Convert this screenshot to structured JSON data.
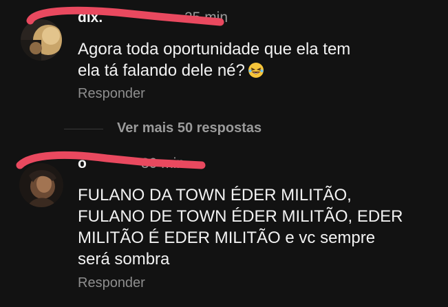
{
  "comments": [
    {
      "username": "dix.",
      "time": "25 min",
      "text": "Agora toda oportunidade que ela tem\nela tá falando dele né?",
      "emoji": "grinning-squinting-face",
      "reply_label": "Responder"
    },
    {
      "username": "o",
      "time": "30 min",
      "text": "FULANO DA TOWN ÉDER MILITÃO,\nFULANO DE TOWN ÉDER MILITÃO, EDER\nMILITÃO É EDER MILITÃO e vc sempre\nserá sombra",
      "reply_label": "Responder"
    }
  ],
  "more_replies_label": "Ver mais 50 respostas",
  "colors": {
    "background": "#121212",
    "redaction": "#e9495f"
  }
}
